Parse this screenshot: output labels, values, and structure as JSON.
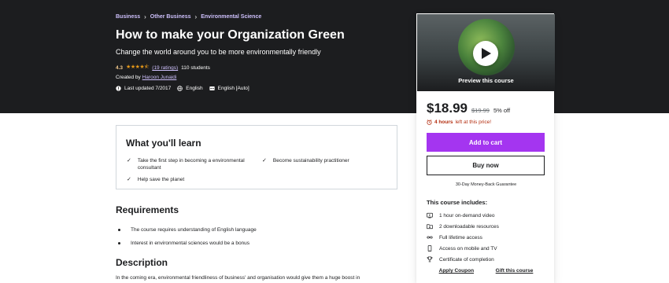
{
  "breadcrumb": [
    "Business",
    "Other Business",
    "Environmental Science"
  ],
  "breadcrumb_sep": "›",
  "course": {
    "title": "How to make your Organization Green",
    "subtitle": "Change the world around you to be more environmentally friendly",
    "rating": "4.3",
    "stars": "★★★★⯪",
    "ratings_count": "(19 ratings)",
    "students": "110 students",
    "created_by_label": "Created by",
    "instructor": "Haroon Junaidi",
    "last_updated": "Last updated 7/2017",
    "language": "English",
    "captions": "English [Auto]"
  },
  "sidebar": {
    "preview_label": "Preview this course",
    "price": "$18.99",
    "original_price": "$19.99",
    "discount": "5% off",
    "timer_bold": "4 hours",
    "timer_rest": "left at this price!",
    "add_to_cart": "Add to cart",
    "buy_now": "Buy now",
    "guarantee": "30-Day Money-Back Guarantee",
    "includes_title": "This course includes:",
    "includes": [
      {
        "icon": "video-icon",
        "label": "1 hour on-demand video"
      },
      {
        "icon": "folder-icon",
        "label": "2 downloadable resources"
      },
      {
        "icon": "infinity-icon",
        "label": "Full lifetime access"
      },
      {
        "icon": "mobile-icon",
        "label": "Access on mobile and TV"
      },
      {
        "icon": "trophy-icon",
        "label": "Certificate of completion"
      }
    ],
    "apply_coupon": "Apply Coupon",
    "gift_course": "Gift this course"
  },
  "learn": {
    "title": "What you'll learn",
    "items": [
      "Take the first step in becoming a environmental consultant",
      "Become sustainability practitioner",
      "Help save the planet"
    ]
  },
  "requirements": {
    "title": "Requirements",
    "items": [
      "The course requires understanding of English language",
      "Interest in environmental sciences would be a bonus"
    ]
  },
  "description": {
    "title": "Description",
    "text": "In the coming era, environmental friendliness of business' and organisation would give them a huge boost in"
  },
  "colors": {
    "accent": "#a435f0",
    "hero_bg": "#1c1d1f",
    "link_purple": "#cec0fc",
    "star": "#e59819",
    "timer": "#b32d0f"
  }
}
